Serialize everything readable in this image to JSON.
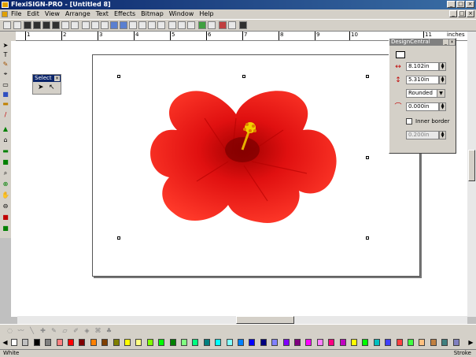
{
  "window": {
    "title": "FlexiSIGN-PRO - [Untitled 8]"
  },
  "menu": {
    "items": [
      "File",
      "Edit",
      "View",
      "Arrange",
      "Text",
      "Effects",
      "Bitmap",
      "Window",
      "Help"
    ]
  },
  "ruler": {
    "unit": "inches",
    "labels": [
      "1",
      "2",
      "3",
      "4",
      "5",
      "6",
      "7",
      "8",
      "9",
      "10",
      "11"
    ]
  },
  "select_panel": {
    "title": "Select"
  },
  "design_central": {
    "title": "DesignCentral",
    "width": "8.102in",
    "height": "5.310in",
    "corner_style": "Rounded",
    "corner_radius": "0.000in",
    "inner_border_label": "Inner border",
    "inner_border_value": "0.200in"
  },
  "status": {
    "fill": "White",
    "stroke": "Stroke"
  },
  "colors": {
    "palette": [
      "#ffffff",
      "#c0c0c0",
      "#000000",
      "#808080",
      "#ff8080",
      "#ff0000",
      "#800000",
      "#ff8000",
      "#804000",
      "#808000",
      "#ffff00",
      "#ffff80",
      "#80ff00",
      "#00ff00",
      "#008000",
      "#80ff80",
      "#00ff80",
      "#008080",
      "#00ffff",
      "#80ffff",
      "#0080ff",
      "#0000ff",
      "#000080",
      "#8080ff",
      "#8000ff",
      "#800080",
      "#ff00ff",
      "#ff80ff",
      "#ff0080",
      "#c000c0",
      "#ffff00",
      "#00ff00",
      "#00c0c0",
      "#4040ff",
      "#ff4040",
      "#40ff40",
      "#ffc080",
      "#c08040",
      "#408080",
      "#8080c0"
    ]
  }
}
